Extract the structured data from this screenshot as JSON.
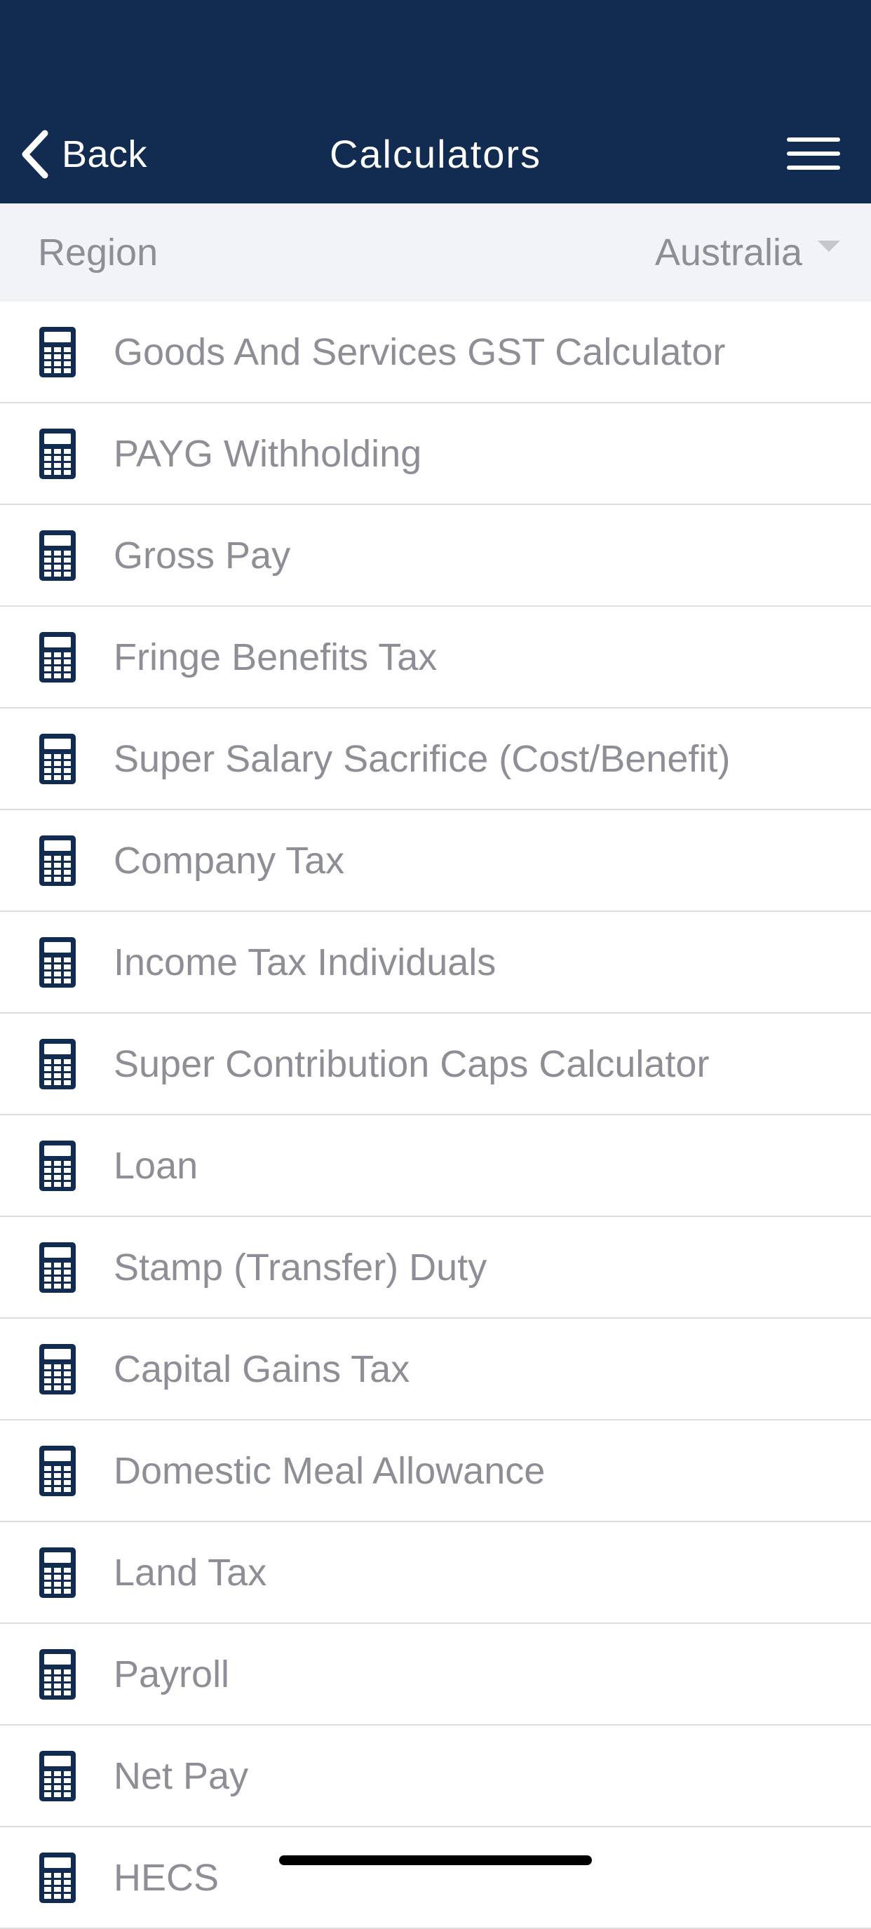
{
  "nav": {
    "back_label": "Back",
    "title": "Calculators"
  },
  "region": {
    "label": "Region",
    "value": "Australia"
  },
  "calculators": [
    {
      "label": "Goods And Services GST Calculator"
    },
    {
      "label": "PAYG Withholding"
    },
    {
      "label": "Gross Pay"
    },
    {
      "label": "Fringe Benefits Tax"
    },
    {
      "label": "Super Salary Sacrifice (Cost/Benefit)"
    },
    {
      "label": "Company Tax"
    },
    {
      "label": "Income Tax Individuals"
    },
    {
      "label": "Super Contribution Caps Calculator"
    },
    {
      "label": "Loan"
    },
    {
      "label": "Stamp (Transfer) Duty"
    },
    {
      "label": "Capital Gains Tax"
    },
    {
      "label": "Domestic Meal Allowance"
    },
    {
      "label": "Land Tax"
    },
    {
      "label": "Payroll"
    },
    {
      "label": "Net Pay"
    },
    {
      "label": "HECS"
    }
  ],
  "colors": {
    "nav_background": "#122b50",
    "icon": "#122b50",
    "text_muted": "#8e8f96",
    "region_background": "#f2f3f6"
  },
  "icons": {
    "back": "chevron-left-icon",
    "menu": "hamburger-menu-icon",
    "row": "calculator-icon",
    "dropdown": "caret-down-icon"
  }
}
